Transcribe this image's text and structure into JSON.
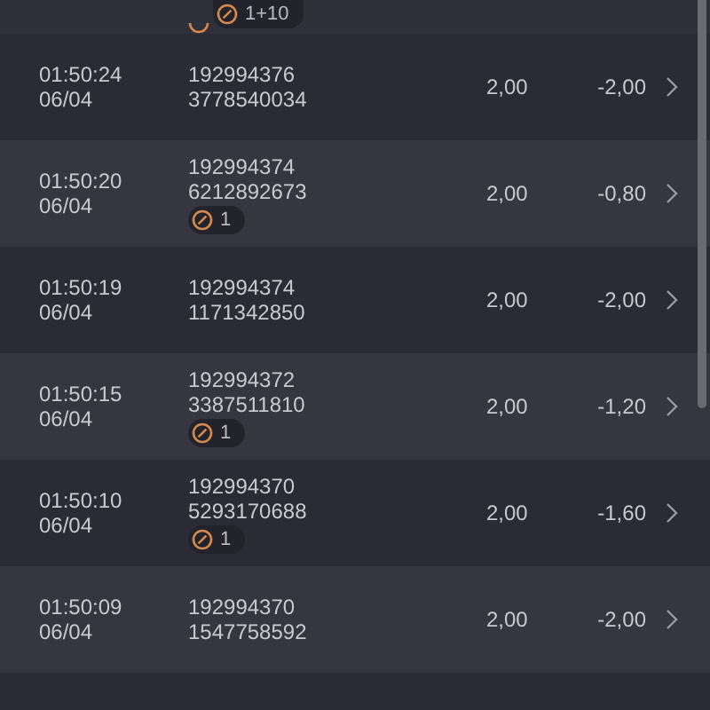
{
  "top_row": {
    "badge": "1+10"
  },
  "rows": [
    {
      "time": "01:50:24",
      "date": "06/04",
      "ticket": "192994376",
      "code": "3778540034",
      "stake": "2,00",
      "result": "-2,00"
    },
    {
      "time": "01:50:20",
      "date": "06/04",
      "ticket": "192994374",
      "code": "6212892673",
      "badge": "1",
      "stake": "2,00",
      "result": "-0,80"
    },
    {
      "time": "01:50:19",
      "date": "06/04",
      "ticket": "192994374",
      "code": "1171342850",
      "stake": "2,00",
      "result": "-2,00"
    },
    {
      "time": "01:50:15",
      "date": "06/04",
      "ticket": "192994372",
      "code": "3387511810",
      "badge": "1",
      "stake": "2,00",
      "result": "-1,20"
    },
    {
      "time": "01:50:10",
      "date": "06/04",
      "ticket": "192994370",
      "code": "5293170688",
      "badge": "1",
      "stake": "2,00",
      "result": "-1,60"
    },
    {
      "time": "01:50:09",
      "date": "06/04",
      "ticket": "192994370",
      "code": "1547758592",
      "stake": "2,00",
      "result": "-2,00"
    }
  ]
}
